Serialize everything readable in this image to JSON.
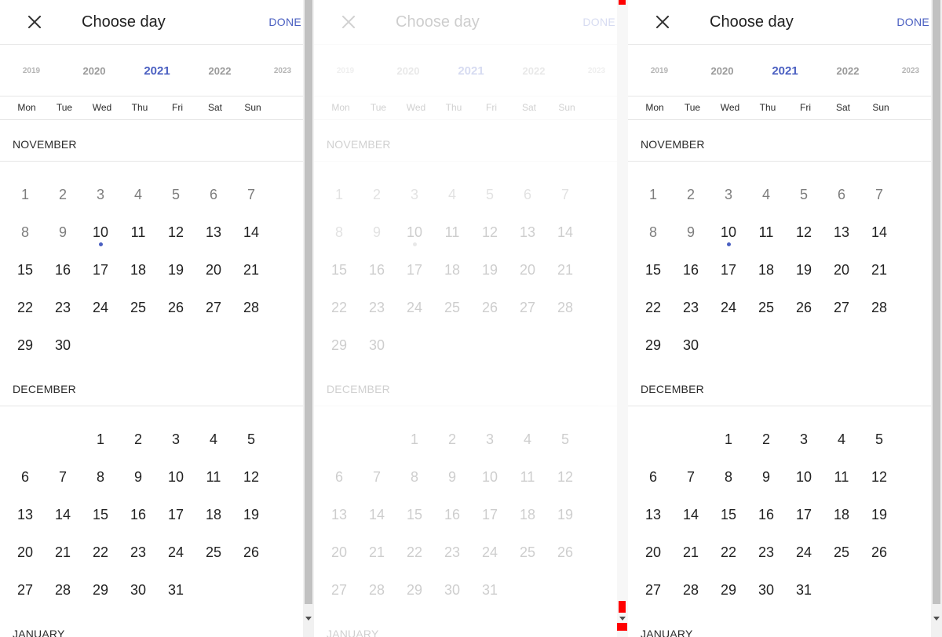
{
  "header": {
    "title": "Choose day",
    "done_label": "DONE"
  },
  "years": [
    "2019",
    "2020",
    "2021",
    "2022",
    "2023"
  ],
  "selected_year": "2021",
  "weekdays": [
    "Mon",
    "Tue",
    "Wed",
    "Thu",
    "Fri",
    "Sat",
    "Sun"
  ],
  "months": [
    {
      "label": "NOVEMBER",
      "first_weekday_index": 0,
      "days": [
        "1",
        "2",
        "3",
        "4",
        "5",
        "6",
        "7",
        "8",
        "9",
        "10",
        "11",
        "12",
        "13",
        "14",
        "15",
        "16",
        "17",
        "18",
        "19",
        "20",
        "21",
        "22",
        "23",
        "24",
        "25",
        "26",
        "27",
        "28",
        "29",
        "30"
      ],
      "past_days": [
        "1",
        "2",
        "3",
        "4",
        "5",
        "6",
        "7",
        "8",
        "9"
      ],
      "today": "10"
    },
    {
      "label": "DECEMBER",
      "first_weekday_index": 2,
      "days": [
        "1",
        "2",
        "3",
        "4",
        "5",
        "6",
        "7",
        "8",
        "9",
        "10",
        "11",
        "12",
        "13",
        "14",
        "15",
        "16",
        "17",
        "18",
        "19",
        "20",
        "21",
        "22",
        "23",
        "24",
        "25",
        "26",
        "27",
        "28",
        "29",
        "30",
        "31"
      ],
      "past_days": [],
      "today": null
    },
    {
      "label": "JANUARY",
      "first_weekday_index": 5,
      "days": [],
      "past_days": [],
      "today": null
    }
  ],
  "panels": [
    {
      "state": "normal"
    },
    {
      "state": "transitioning"
    },
    {
      "state": "normal"
    }
  ],
  "colors": {
    "accent": "#4a5fc1",
    "text": "#222222",
    "past_text": "#7d7d7d",
    "divider": "#e6e6e6",
    "marker": "#ff0000"
  },
  "icons": {
    "close": "close-icon",
    "today": "today-dot-icon",
    "scroll_down": "scroll-down-arrow-icon"
  }
}
